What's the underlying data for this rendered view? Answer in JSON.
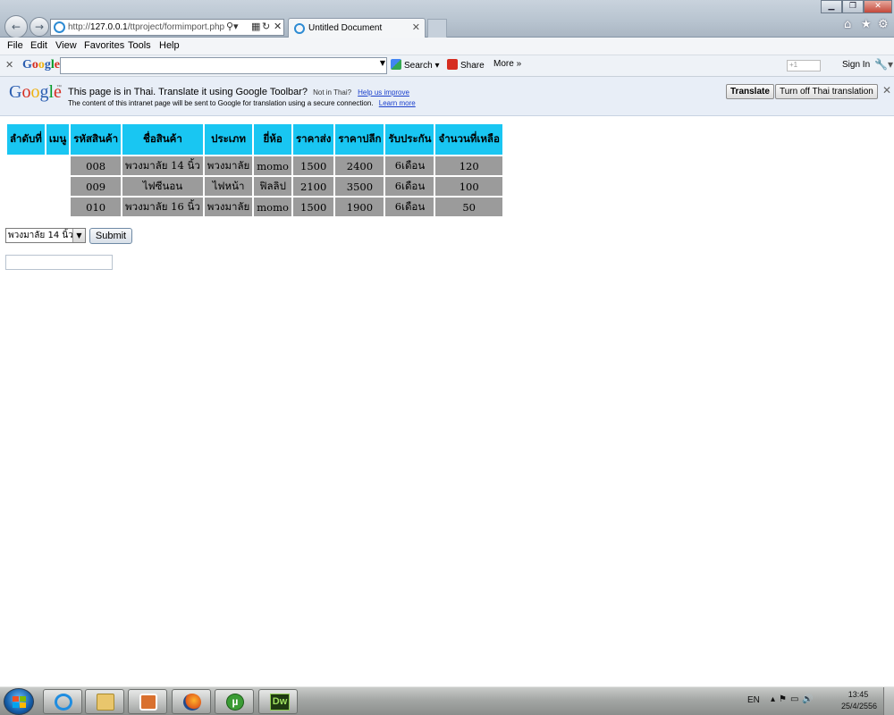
{
  "browser": {
    "address_prefix": "http://",
    "address_host": "127.0.0.1",
    "address_path": "/ttproject/formimport.php",
    "tab_title": "Untitled Document"
  },
  "menu": {
    "items": [
      {
        "label": "File"
      },
      {
        "label": "Edit"
      },
      {
        "label": "View"
      },
      {
        "label": "Favorites"
      },
      {
        "label": "Tools"
      },
      {
        "label": "Help"
      }
    ]
  },
  "google_toolbar": {
    "logo": "Google",
    "search_label": "Search",
    "share_label": "Share",
    "more_label": "More",
    "signin_label": "Sign In"
  },
  "translate_bar": {
    "logo": "Google",
    "message": "This page is in Thai.  Translate it using Google Toolbar?",
    "not_in_thai": "Not in Thai?",
    "help_link": "Help us improve",
    "sub_message": "The content of this intranet page will be sent to Google for translation using a secure connection.",
    "learn_more": "Learn more",
    "translate_button": "Translate",
    "turn_off_button": "Turn off Thai translation"
  },
  "table": {
    "headers": [
      "ลำดับที่",
      "เมนู",
      "รหัสสินค้า",
      "ชื่อสินค้า",
      "ประเภท",
      "ยี่ห้อ",
      "ราคาส่ง",
      "ราคาปลีก",
      "รับประกัน",
      "จำนวนที่เหลือ"
    ],
    "rows": [
      [
        "",
        "",
        "008",
        "พวงมาลัย 14 นิ้ว",
        "พวงมาลัย",
        "momo",
        "1500",
        "2400",
        "6เดือน",
        "120"
      ],
      [
        "",
        "",
        "009",
        "ไฟซีนอน",
        "ไฟหน้า",
        "ฟิลลิป",
        "2100",
        "3500",
        "6เดือน",
        "100"
      ],
      [
        "",
        "",
        "010",
        "พวงมาลัย 16 นิ้ว",
        "พวงมาลัย",
        "momo",
        "1500",
        "1900",
        "6เดือน",
        "50"
      ]
    ]
  },
  "form": {
    "select_value": "พวงมาลัย 14 นิ้ว",
    "submit_label": "Submit",
    "text_value": ""
  },
  "taskbar": {
    "dw_label": "Dw",
    "lang": "EN",
    "time": "13:45",
    "date": "25/4/2556"
  },
  "colors": {
    "table_header": "#19c6f2",
    "table_cell": "#9b9b9b"
  }
}
